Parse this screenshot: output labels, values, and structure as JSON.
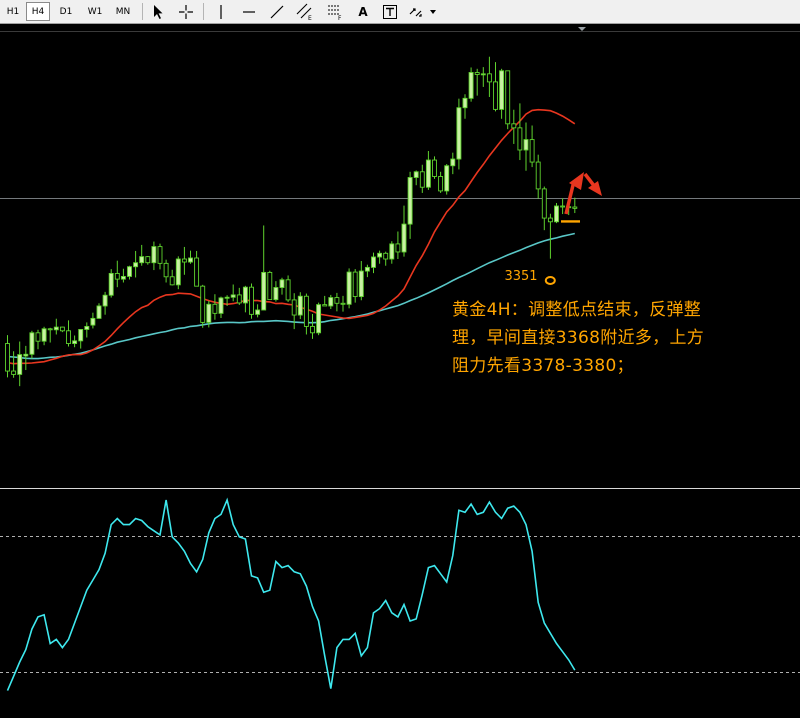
{
  "toolbar": {
    "timeframes": [
      "H1",
      "H4",
      "D1",
      "W1",
      "MN"
    ],
    "active_timeframe": "H4",
    "text_tool_label": "A",
    "tools": [
      "cursor-arrow-icon",
      "crosshair-icon",
      "vertical-line-icon",
      "horizontal-line-icon",
      "trendline-icon",
      "equidistant-channel-icon",
      "fibonacci-icon",
      "text-icon",
      "text-label-icon",
      "arrows-dropdown-icon"
    ]
  },
  "annotation": {
    "low_label": "3351",
    "note": "黄金4H：调整低点结束，反弹整\n理，早间直接3368附近多，上方\n阻力先看3378-3380；"
  },
  "colors": {
    "background": "#000000",
    "candle_up_body": "#c9f1a3",
    "candle_down_body": "#000000",
    "candle_outline": "#5fd32e",
    "ma_fast": "#e8361f",
    "ma_slow": "#59c7c7",
    "oscillator": "#3ee8ee",
    "annotation": "#ffa500",
    "arrow": "#e8361f",
    "level_line": "#9aa1a6",
    "level_dotted": "#b0b0b0"
  },
  "chart_data": {
    "type": "candlestick",
    "y_axis": "price",
    "candles": [
      [
        3331.6,
        3334.1,
        3321.5,
        3323.4
      ],
      [
        3323.4,
        3329.3,
        3321.4,
        3322.4
      ],
      [
        3322.4,
        3332.2,
        3318.9,
        3328.3
      ],
      [
        3327.9,
        3330.9,
        3323.7,
        3328.4
      ],
      [
        3328.4,
        3335.4,
        3327.1,
        3334.8
      ],
      [
        3334.8,
        3335.7,
        3329.9,
        3332.3
      ],
      [
        3332.3,
        3336.6,
        3331.1,
        3336.0
      ],
      [
        3336.0,
        3336.3,
        3331.9,
        3335.7
      ],
      [
        3335.7,
        3339.0,
        3334.3,
        3336.5
      ],
      [
        3336.5,
        3336.6,
        3335.0,
        3335.4
      ],
      [
        3335.4,
        3338.5,
        3330.7,
        3331.6
      ],
      [
        3331.6,
        3334.0,
        3330.5,
        3332.4
      ],
      [
        3332.4,
        3335.9,
        3330.1,
        3335.8
      ],
      [
        3335.8,
        3337.9,
        3333.4,
        3336.7
      ],
      [
        3337.1,
        3340.8,
        3336.1,
        3339.1
      ],
      [
        3339.1,
        3343.6,
        3339.0,
        3342.8
      ],
      [
        3342.8,
        3347.0,
        3340.2,
        3346.0
      ],
      [
        3346.0,
        3353.8,
        3345.3,
        3352.5
      ],
      [
        3352.5,
        3356.3,
        3348.4,
        3350.8
      ],
      [
        3350.8,
        3353.9,
        3349.8,
        3351.6
      ],
      [
        3351.6,
        3354.8,
        3350.7,
        3354.5
      ],
      [
        3354.5,
        3359.2,
        3351.3,
        3355.7
      ],
      [
        3355.7,
        3361.0,
        3354.8,
        3357.5
      ],
      [
        3357.5,
        3357.7,
        3355.1,
        3355.7
      ],
      [
        3355.7,
        3362.0,
        3353.5,
        3360.5
      ],
      [
        3360.5,
        3361.4,
        3353.7,
        3355.5
      ],
      [
        3355.5,
        3356.6,
        3349.8,
        3351.5
      ],
      [
        3351.5,
        3353.6,
        3348.9,
        3349.1
      ],
      [
        3349.1,
        3357.6,
        3347.8,
        3356.8
      ],
      [
        3356.8,
        3360.4,
        3352.1,
        3355.9
      ],
      [
        3355.9,
        3359.3,
        3355.4,
        3357.1
      ],
      [
        3357.1,
        3359.2,
        3349.7,
        3348.7
      ],
      [
        3348.7,
        3349.1,
        3336.3,
        3337.9
      ],
      [
        3337.9,
        3344.3,
        3336.4,
        3343.3
      ],
      [
        3343.3,
        3346.3,
        3338.7,
        3340.6
      ],
      [
        3340.6,
        3345.6,
        3339.2,
        3345.2
      ],
      [
        3345.2,
        3346.0,
        3342.8,
        3345.4
      ],
      [
        3345.4,
        3349.2,
        3344.2,
        3346.1
      ],
      [
        3346.1,
        3348.2,
        3343.1,
        3343.7
      ],
      [
        3343.7,
        3348.8,
        3340.9,
        3348.4
      ],
      [
        3348.4,
        3349.5,
        3339.0,
        3340.3
      ],
      [
        3340.3,
        3343.3,
        3339.4,
        3341.6
      ],
      [
        3341.6,
        3366.8,
        3341.6,
        3352.8
      ],
      [
        3352.8,
        3353.3,
        3344.7,
        3344.7
      ],
      [
        3344.7,
        3350.2,
        3344.1,
        3348.3
      ],
      [
        3348.3,
        3351.2,
        3346.2,
        3350.6
      ],
      [
        3350.6,
        3351.9,
        3344.0,
        3344.6
      ],
      [
        3344.6,
        3346.6,
        3335.9,
        3340.1
      ],
      [
        3340.1,
        3346.9,
        3338.9,
        3345.7
      ],
      [
        3345.7,
        3346.5,
        3334.3,
        3336.7
      ],
      [
        3336.7,
        3340.4,
        3333.0,
        3334.8
      ],
      [
        3334.8,
        3343.8,
        3334.1,
        3343.2
      ],
      [
        3343.2,
        3345.8,
        3342.8,
        3342.8
      ],
      [
        3342.8,
        3346.1,
        3341.9,
        3345.3
      ],
      [
        3345.3,
        3346.7,
        3341.2,
        3343.6
      ],
      [
        3343.6,
        3345.8,
        3341.1,
        3343.3
      ],
      [
        3343.3,
        3354.0,
        3342.1,
        3352.9
      ],
      [
        3352.9,
        3353.8,
        3343.8,
        3345.6
      ],
      [
        3345.6,
        3356.2,
        3344.5,
        3353.2
      ],
      [
        3353.2,
        3355.1,
        3351.4,
        3354.3
      ],
      [
        3354.3,
        3358.7,
        3352.6,
        3357.4
      ],
      [
        3357.4,
        3359.3,
        3355.4,
        3358.5
      ],
      [
        3358.5,
        3359.0,
        3354.8,
        3356.8
      ],
      [
        3356.8,
        3362.1,
        3355.4,
        3361.3
      ],
      [
        3361.3,
        3365.0,
        3356.8,
        3358.9
      ],
      [
        3358.9,
        3372.7,
        3357.5,
        3367.2
      ],
      [
        3367.2,
        3382.8,
        3362.8,
        3381.1
      ],
      [
        3381.1,
        3383.2,
        3378.8,
        3382.8
      ],
      [
        3382.8,
        3384.9,
        3376.5,
        3378.2
      ],
      [
        3378.2,
        3389.0,
        3377.4,
        3386.3
      ],
      [
        3386.3,
        3387.4,
        3380.7,
        3381.4
      ],
      [
        3381.4,
        3382.8,
        3376.5,
        3377.1
      ],
      [
        3377.1,
        3385.1,
        3376.0,
        3384.6
      ],
      [
        3384.6,
        3388.5,
        3382.1,
        3386.6
      ],
      [
        3386.6,
        3404.6,
        3383.5,
        3401.9
      ],
      [
        3401.9,
        3405.9,
        3398.6,
        3404.7
      ],
      [
        3404.7,
        3413.9,
        3403.7,
        3412.4
      ],
      [
        3412.4,
        3413.5,
        3405.5,
        3411.8
      ],
      [
        3411.8,
        3414.0,
        3408.1,
        3412.0
      ],
      [
        3412.0,
        3417.1,
        3405.1,
        3409.6
      ],
      [
        3409.6,
        3415.5,
        3400.8,
        3401.4
      ],
      [
        3401.4,
        3413.5,
        3398.6,
        3412.9
      ],
      [
        3412.9,
        3412.9,
        3395.5,
        3397.1
      ],
      [
        3397.1,
        3401.3,
        3391.1,
        3395.9
      ],
      [
        3395.9,
        3403.2,
        3386.3,
        3389.3
      ],
      [
        3389.3,
        3397.5,
        3383.1,
        3392.4
      ],
      [
        3392.4,
        3396.6,
        3384.2,
        3385.7
      ],
      [
        3385.7,
        3387.9,
        3374.8,
        3377.7
      ],
      [
        3377.7,
        3378.4,
        3365.4,
        3369.0
      ],
      [
        3369.0,
        3370.3,
        3356.9,
        3367.9
      ],
      [
        3367.9,
        3373.5,
        3367.5,
        3372.6
      ],
      [
        3372.6,
        3374.9,
        3370.2,
        3372.4
      ],
      [
        3372.4,
        3373.4,
        3369.9,
        3372.3
      ],
      [
        3372.3,
        3375.1,
        3370.5,
        3371.9
      ]
    ],
    "ma_fast_values": [
      3325.9,
      3325.6,
      3325.7,
      3325.7,
      3325.8,
      3326.0,
      3326.2,
      3326.7,
      3327.2,
      3327.8,
      3328.2,
      3328.3,
      3328.3,
      3328.8,
      3329.7,
      3330.9,
      3332.2,
      3334.0,
      3336.0,
      3337.8,
      3339.5,
      3341.1,
      3342.3,
      3343.0,
      3344.5,
      3345.4,
      3346.1,
      3346.2,
      3346.6,
      3346.5,
      3346.4,
      3345.7,
      3345.0,
      3344.4,
      3343.9,
      3343.6,
      3343.3,
      3343.5,
      3343.9,
      3344.5,
      3344.4,
      3344.4,
      3344.1,
      3344.0,
      3343.5,
      3343.6,
      3343.3,
      3343.1,
      3342.4,
      3341.8,
      3341.2,
      3340.4,
      3340.1,
      3339.8,
      3339.5,
      3339.2,
      3339.1,
      3339.4,
      3339.7,
      3340.0,
      3340.6,
      3341.6,
      3342.8,
      3344.3,
      3345.8,
      3347.9,
      3351.4,
      3354.9,
      3357.8,
      3361.2,
      3364.9,
      3367.9,
      3370.8,
      3372.8,
      3375.3,
      3377.2,
      3379.9,
      3382.6,
      3385.0,
      3387.6,
      3389.9,
      3392.2,
      3394.2,
      3396.1,
      3397.9,
      3400.0,
      3401.1,
      3401.3,
      3401.2,
      3401.0,
      3400.3,
      3399.4,
      3398.3,
      3397.1
    ],
    "ma_slow_values": [
      3327.7,
      3327.6,
      3327.4,
      3327.2,
      3327.1,
      3327.1,
      3327.3,
      3327.5,
      3327.6,
      3327.8,
      3328.1,
      3328.4,
      3328.7,
      3329.2,
      3329.7,
      3330.3,
      3330.9,
      3331.4,
      3332.0,
      3332.4,
      3332.8,
      3333.3,
      3333.7,
      3334.1,
      3334.5,
      3334.9,
      3335.2,
      3335.7,
      3336.1,
      3336.3,
      3336.7,
      3336.9,
      3337.2,
      3337.5,
      3337.7,
      3337.8,
      3337.9,
      3337.9,
      3337.8,
      3337.9,
      3338.1,
      3338.2,
      3338.2,
      3338.3,
      3338.4,
      3338.3,
      3338.2,
      3338.0,
      3337.9,
      3337.8,
      3337.8,
      3337.9,
      3338.1,
      3338.5,
      3338.7,
      3339.0,
      3339.3,
      3339.6,
      3340.0,
      3340.4,
      3340.9,
      3341.4,
      3341.9,
      3342.4,
      3342.9,
      3343.6,
      3344.4,
      3345.1,
      3345.9,
      3346.7,
      3347.6,
      3348.5,
      3349.4,
      3350.4,
      3351.3,
      3352.1,
      3353.0,
      3353.9,
      3354.8,
      3355.7,
      3356.4,
      3357.2,
      3358.0,
      3358.7,
      3359.4,
      3360.2,
      3360.9,
      3361.6,
      3362.2,
      3362.7,
      3363.1,
      3363.6,
      3364.0,
      3364.4
    ],
    "level_line": 3374.8,
    "low_point": 3351,
    "support_mark": 3368,
    "oscillator_values": [
      7,
      14,
      21,
      27,
      37,
      43,
      44,
      30,
      32,
      28,
      32,
      40,
      48,
      56,
      61,
      66,
      74,
      88,
      91,
      88,
      88,
      91,
      90,
      87,
      85,
      83,
      100,
      82,
      79,
      75,
      69,
      65,
      71,
      84,
      91,
      93,
      100,
      88,
      82,
      81,
      63,
      62,
      55,
      56,
      70,
      67,
      68,
      65,
      64,
      58,
      48,
      41,
      24,
      8,
      28,
      32,
      32,
      35,
      24,
      28,
      45,
      47,
      51,
      45,
      43,
      49,
      41,
      42,
      54,
      67,
      68,
      64,
      60,
      73,
      95,
      94,
      98,
      93,
      94,
      99,
      94,
      91,
      96,
      97,
      94,
      88,
      75,
      50,
      40,
      35,
      30,
      26,
      22,
      17
    ]
  }
}
